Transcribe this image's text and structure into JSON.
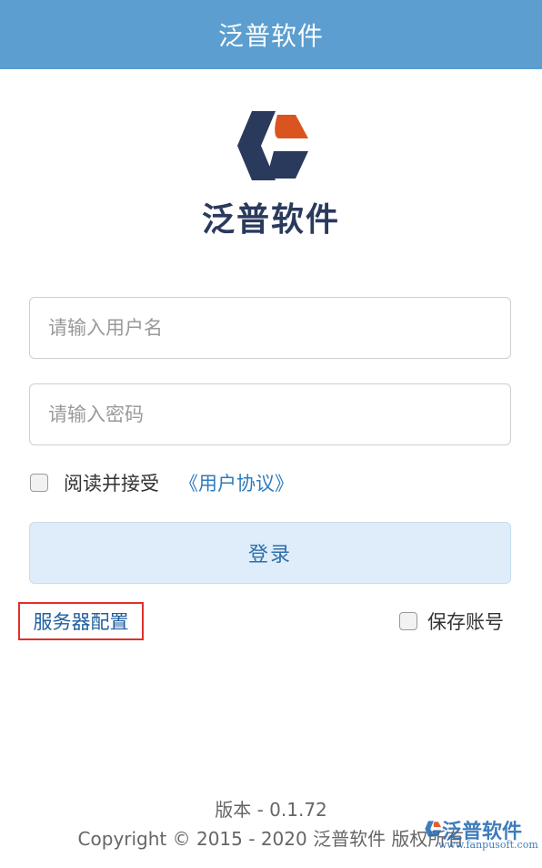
{
  "header": {
    "title": "泛普软件"
  },
  "brand": {
    "logo_icon": "fanpu-logo-icon",
    "name": "泛普软件",
    "colors": {
      "navy": "#2a3a5c",
      "orange": "#d9541e",
      "header_bg": "#5b9ecf"
    }
  },
  "form": {
    "username_placeholder": "请输入用户名",
    "username_value": "",
    "password_placeholder": "请输入密码",
    "password_value": "",
    "agree_label": "阅读并接受",
    "agree_checked": false,
    "agreement_link": "《用户协议》",
    "login_button": "登录",
    "server_config_link": "服务器配置",
    "save_account_label": "保存账号",
    "save_account_checked": false
  },
  "footer": {
    "version": "版本 - 0.1.72",
    "copyright": "Copyright © 2015 - 2020 泛普软件 版权所有"
  },
  "watermark": {
    "name": "泛普软件",
    "url": "www.fanpusoft.com"
  }
}
